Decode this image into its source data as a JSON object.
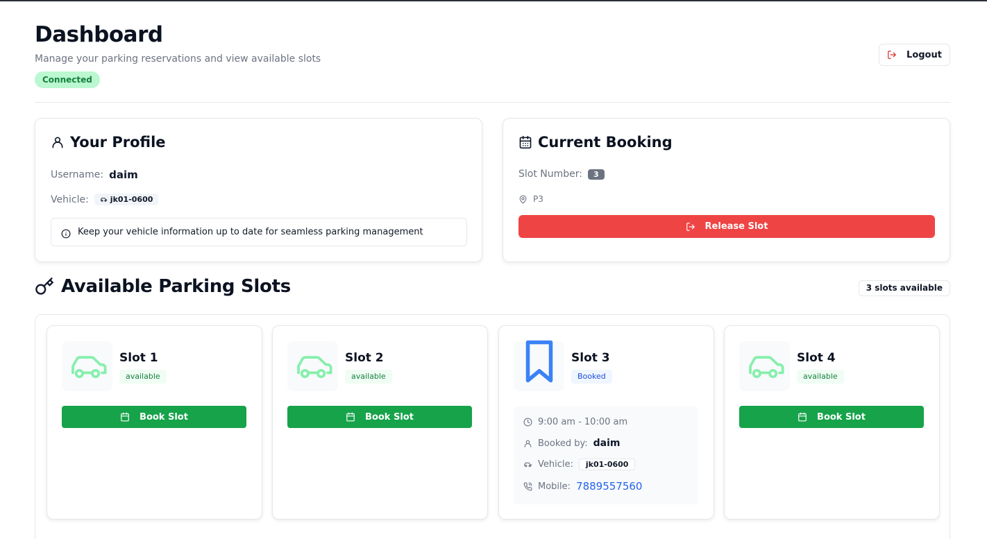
{
  "header": {
    "title": "Dashboard",
    "subtitle": "Manage your parking reservations and view available slots",
    "connection_status": "Connected",
    "logout_label": "Logout"
  },
  "profile": {
    "title": "Your Profile",
    "username_label": "Username:",
    "username": "daim",
    "vehicle_label": "Vehicle:",
    "vehicle": "jk01-0600",
    "info_text": "Keep your vehicle information up to date for seamless parking management"
  },
  "booking": {
    "title": "Current Booking",
    "slot_number_label": "Slot Number:",
    "slot_number": "3",
    "location": "P3",
    "release_label": "Release Slot"
  },
  "slots_section": {
    "title": "Available Parking Slots",
    "count_label": "3 slots available"
  },
  "slots": [
    {
      "name": "Slot 1",
      "status": "available",
      "button": "Book Slot",
      "icon": "car-icon"
    },
    {
      "name": "Slot 2",
      "status": "available",
      "button": "Book Slot",
      "icon": "car-icon"
    },
    {
      "name": "Slot 3",
      "status": "Booked",
      "icon": "bookmark-icon",
      "details": {
        "time": "9:00 am - 10:00 am",
        "booked_by_label": "Booked by:",
        "booked_by": "daim",
        "vehicle_label": "Vehicle:",
        "vehicle": "jk01-0600",
        "mobile_label": "Mobile:",
        "mobile": "7889557560"
      }
    },
    {
      "name": "Slot 4",
      "status": "available",
      "button": "Book Slot",
      "icon": "car-icon"
    }
  ],
  "colors": {
    "success": "#16a34a",
    "danger": "#ef4444",
    "accent": "#3b82f6",
    "connected_bg": "#bbf7d0",
    "car_icon": "#86efac"
  }
}
